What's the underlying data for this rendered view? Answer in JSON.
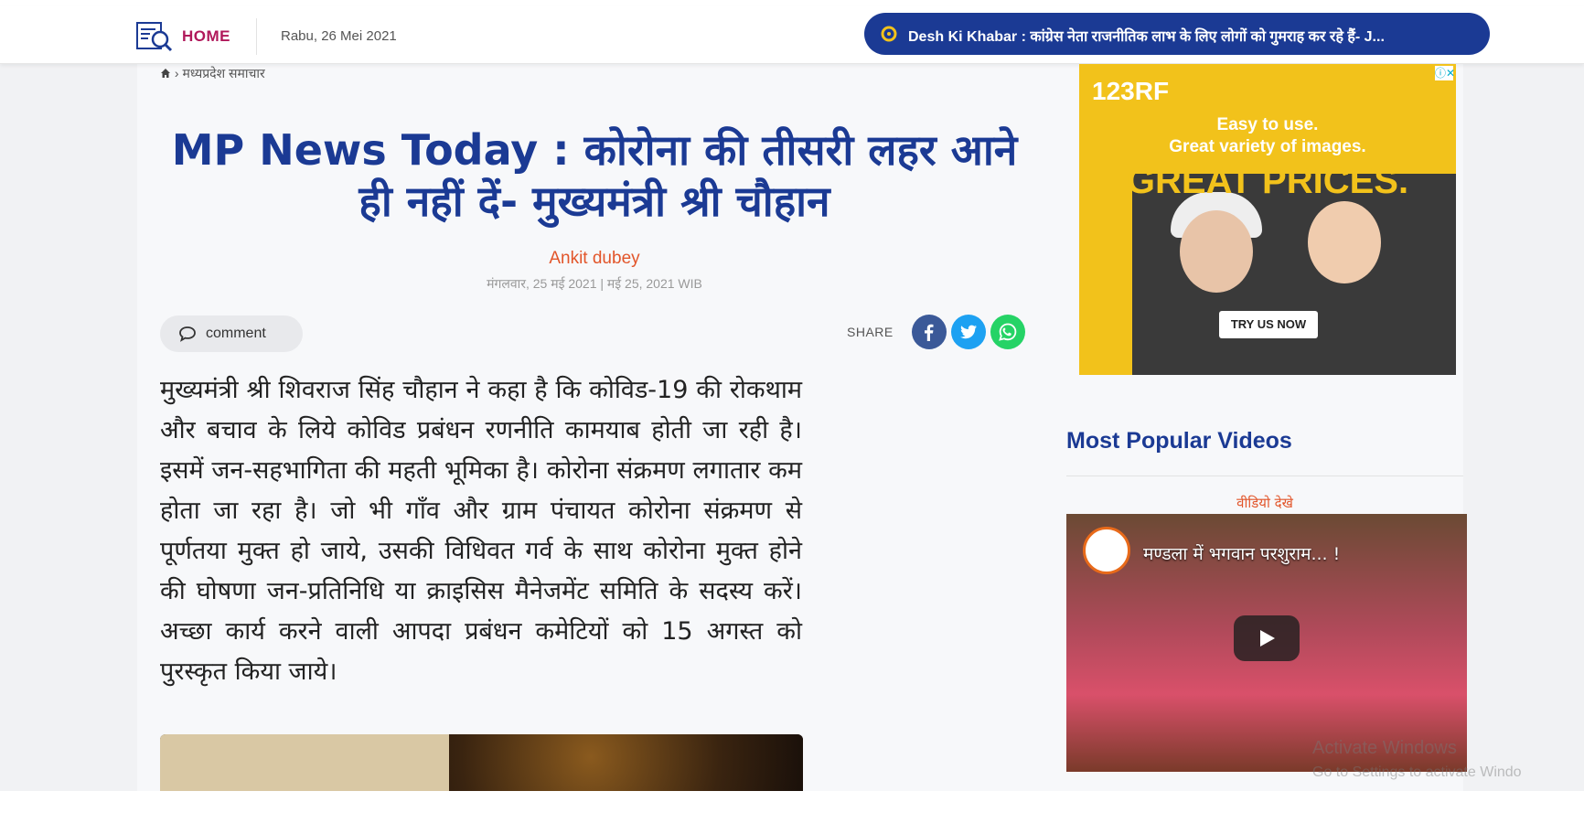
{
  "header": {
    "home_label": "HOME",
    "date": "Rabu, 26 Mei 2021",
    "ticker_text": "Desh Ki Khabar : कांग्रेस नेता राजनीतिक लाभ के लिए लोगों को गुमराह कर रहे हैं- J..."
  },
  "breadcrumb": {
    "current": "मध्यप्रदेश समाचार"
  },
  "article": {
    "headline": "MP News Today : कोरोना की तीसरी लहर आने ही नहीं दें- मुख्यमंत्री श्री चौहान",
    "author": "Ankit dubey",
    "published": "मंगलवार, 25 मई 2021 | मई 25, 2021 WIB",
    "comment_label": "comment",
    "share_label": "SHARE",
    "body": "मुख्यमंत्री श्री शिवराज सिंह चौहान ने कहा है कि कोविड-19 की रोकथाम और बचाव के लिये कोविड प्रबंधन रणनीति कामयाब होती जा रही है। इसमें जन-सहभागिता की महती भूमिका है। कोरोना संक्रमण लगातार कम होता जा रहा है। जो भी गाँव और ग्राम पंचायत कोरोना संक्रमण से पूर्णतया मुक्त हो जाये, उसकी विधिवत गर्व के साथ कोरोना मुक्त होने की घोषणा जन-प्रतिनिधि या क्राइसिस मैनेजमेंट समिति के सदस्य करें। अच्छा कार्य करने वाली आपदा प्रबंधन कमेटियों को 15 अगस्त को पुरस्कृत किया जाये।"
  },
  "ad": {
    "brand": "123RF",
    "line1": "Easy to use.",
    "line2": "Great variety of images.",
    "headline": "GREAT PRICES.",
    "cta": "TRY US NOW"
  },
  "sidebar": {
    "section_title": "Most Popular Videos",
    "video_label": "वीडियो देखे",
    "video_title": "मण्डला में भगवान परशुराम...",
    "video_title_suffix": "!"
  },
  "overlay": {
    "activate_line1": "Activate Windows",
    "activate_line2": "Go to Settings to activate Windo"
  },
  "colors": {
    "brand_blue": "#1b3a94",
    "accent_magenta": "#b0185a",
    "author_orange": "#e2552a",
    "facebook": "#3b5998",
    "twitter": "#1da1f2",
    "whatsapp": "#25d366",
    "ad_yellow": "#f2c21b"
  },
  "icons": [
    "search-logo-icon",
    "home-icon",
    "ticker-bullet-icon",
    "comment-icon",
    "facebook-icon",
    "twitter-icon",
    "whatsapp-icon",
    "play-icon",
    "ad-close-icon"
  ]
}
